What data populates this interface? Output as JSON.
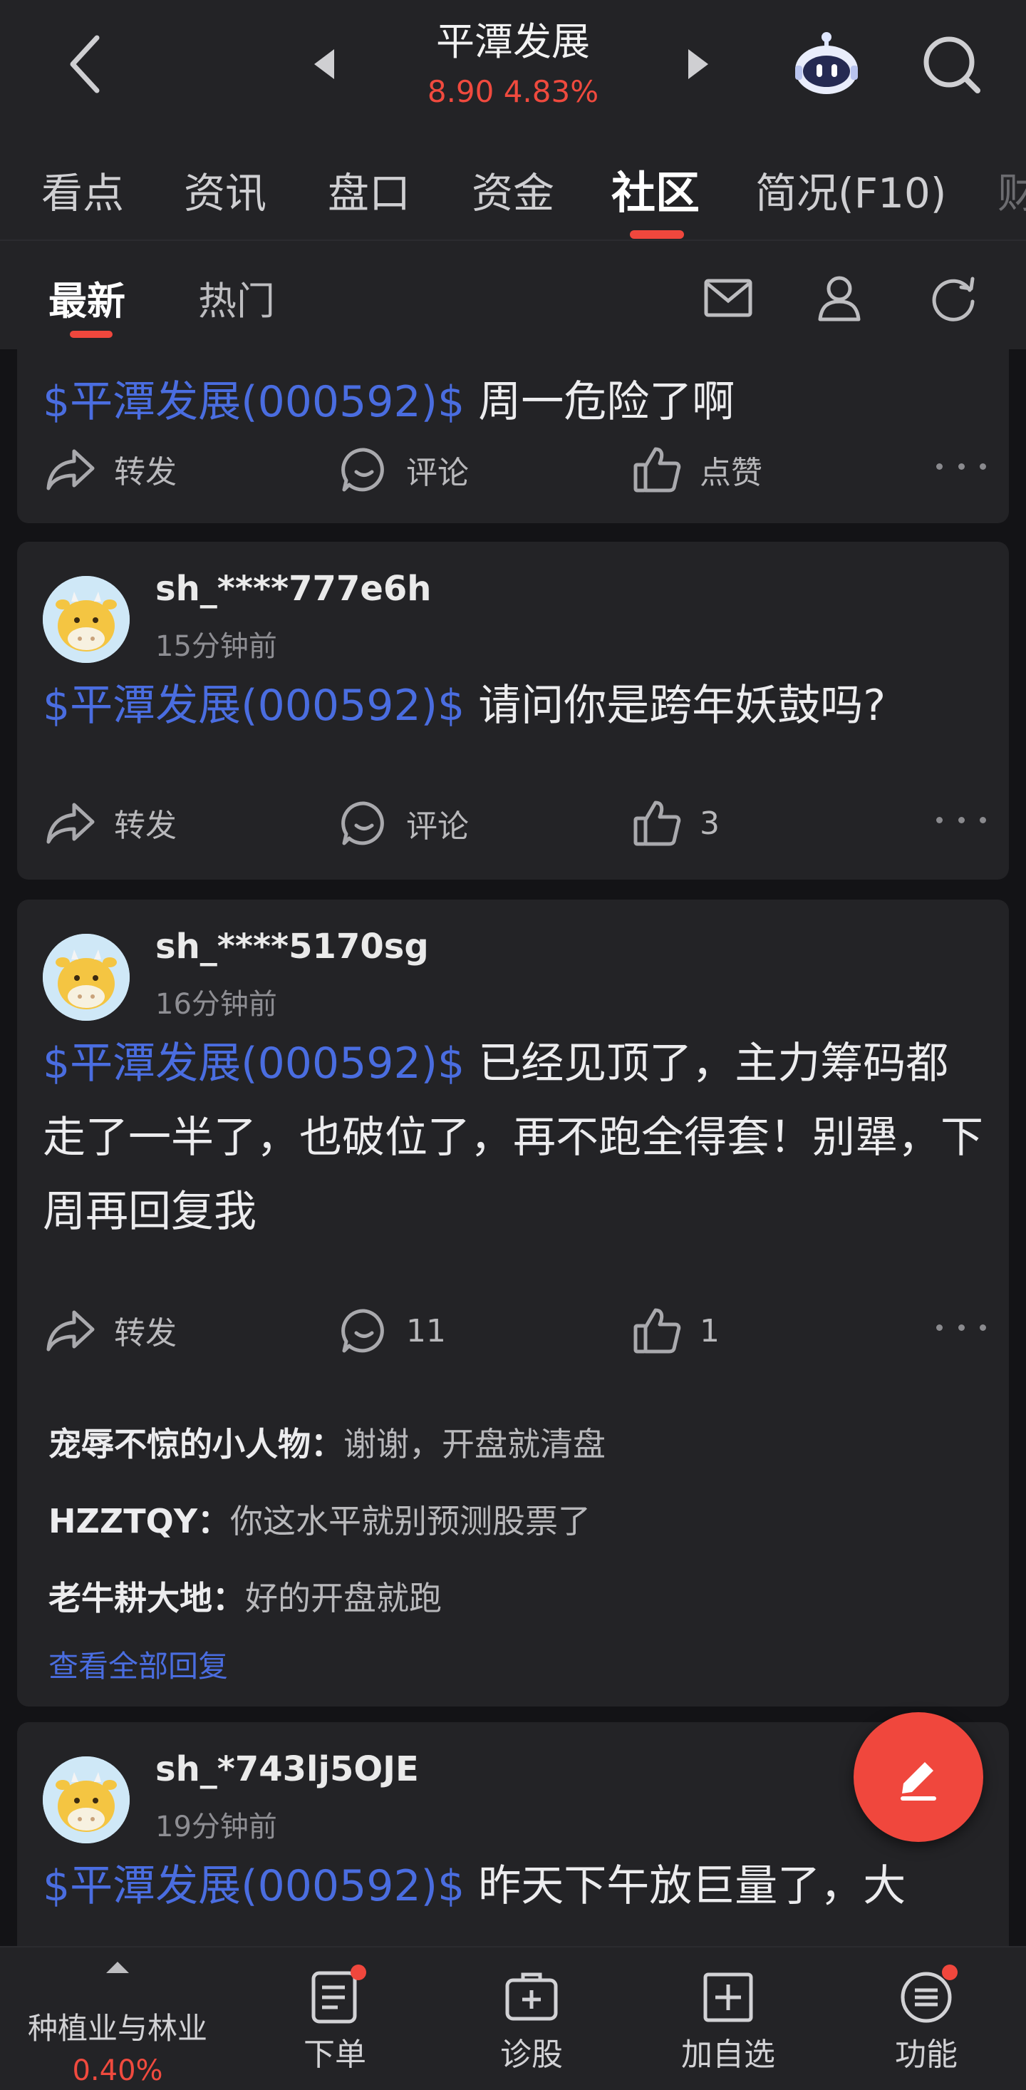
{
  "header": {
    "title": "平潭发展",
    "price_line": "8.90 4.83%",
    "icons": [
      "back-icon",
      "prev-arrow-icon",
      "next-arrow-icon",
      "robot-assistant-icon",
      "search-icon"
    ]
  },
  "tabs": {
    "items": [
      "看点",
      "资讯",
      "盘口",
      "资金",
      "社区",
      "简况(F10)",
      "财"
    ],
    "active": "社区"
  },
  "subtabs": {
    "latest": "最新",
    "hot": "热门",
    "icons": [
      "mail-icon",
      "user-icon",
      "refresh-icon"
    ]
  },
  "posts": [
    {
      "stock": "$平潭发展(000592)$",
      "text": " 周一危险了啊",
      "forward": "转发",
      "comment": "评论",
      "like": "点赞"
    },
    {
      "user": "sh_****777e6h",
      "time": "15分钟前",
      "stock": "$平潭发展(000592)$",
      "text": " 请问你是跨年妖鼓吗?",
      "forward": "转发",
      "comment": "评论",
      "like": "3"
    },
    {
      "user": "sh_****5170sg",
      "time": "16分钟前",
      "stock": "$平潭发展(000592)$",
      "text": " 已经见顶了，主力筹码都走了一半了，也破位了，再不跑全得套！别犟，下周再回复我",
      "forward": "转发",
      "comment": "11",
      "like": "1",
      "replies": [
        {
          "author": "宠辱不惊的小人物：",
          "text": "谢谢，开盘就清盘"
        },
        {
          "author": "HZZTQY：",
          "text": "你这水平就别预测股票了"
        },
        {
          "author": "老牛耕大地：",
          "text": "好的开盘就跑"
        }
      ],
      "view_all": "查看全部回复"
    },
    {
      "user": "sh_*743lj5OJE",
      "time": "19分钟前",
      "stock": "$平潭发展(000592)$",
      "text": " 昨天下午放巨量了，大"
    }
  ],
  "fab": {
    "icon": "edit-pen-icon"
  },
  "bottombar": {
    "sector_name": "种植业与林业",
    "sector_change": "0.40%",
    "items": [
      {
        "label": "下单",
        "icon": "order-icon",
        "badge": true
      },
      {
        "label": "诊股",
        "icon": "diagnose-icon",
        "badge": false
      },
      {
        "label": "加自选",
        "icon": "add-watchlist-icon",
        "badge": false
      },
      {
        "label": "功能",
        "icon": "menu-icon",
        "badge": true
      }
    ]
  },
  "colors": {
    "accent": "#f0473d",
    "link": "#4a6de0",
    "bg": "#131316",
    "card": "#232326"
  }
}
